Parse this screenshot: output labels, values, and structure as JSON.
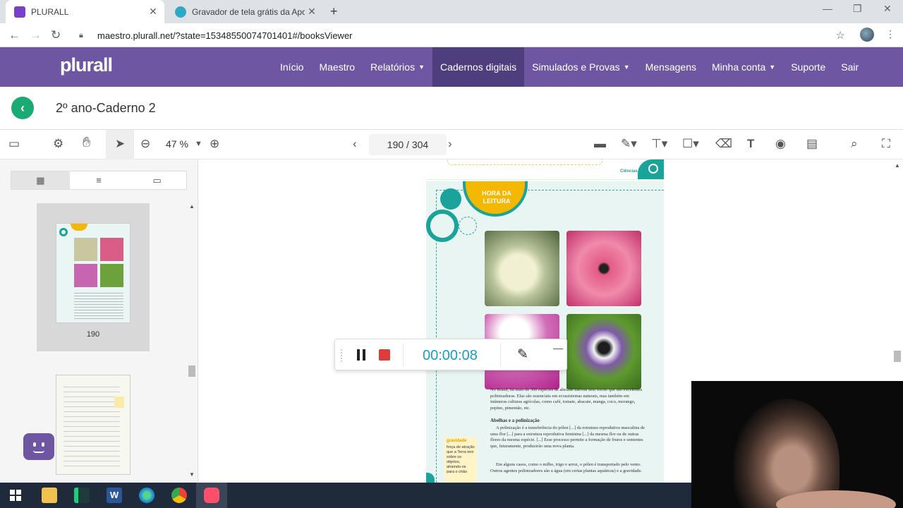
{
  "browser": {
    "tabs": [
      {
        "title": "PLURALL",
        "active": true
      },
      {
        "title": "Gravador de tela grátis da Apowersoft",
        "active": false
      }
    ],
    "new_tab": "+",
    "url": "maestro.plurall.net/?state=15348550074701401#/booksViewer"
  },
  "nav": {
    "logo": "plurall",
    "items": [
      {
        "label": "Início",
        "caret": false,
        "active": false
      },
      {
        "label": "Maestro",
        "caret": false,
        "active": false
      },
      {
        "label": "Relatórios",
        "caret": true,
        "active": false
      },
      {
        "label": "Cadernos digitais",
        "caret": false,
        "active": true
      },
      {
        "label": "Simulados e Provas",
        "caret": true,
        "active": false
      },
      {
        "label": "Mensagens",
        "caret": false,
        "active": false
      },
      {
        "label": "Minha conta",
        "caret": true,
        "active": false
      },
      {
        "label": "Suporte",
        "caret": false,
        "active": false
      },
      {
        "label": "Sair",
        "caret": false,
        "active": false
      }
    ]
  },
  "document": {
    "title": "2º ano-Caderno 2"
  },
  "toolbar": {
    "zoom": "47 %",
    "page_indicator": "190 / 304"
  },
  "sidebar": {
    "thumb_label": "190"
  },
  "page": {
    "section_badge": "HORA DA LEITURA",
    "corner_label": "Ciências",
    "intro": "No Brasil, há mais de 300 espécies de abelhas nativas sem ferrão que são excelentes polinizadoras. Elas são essenciais em ecossistemas naturais, mas também em inúmeras culturas agrícolas, como café, tomate, abacate, manga, coco, morango, pepino, pimentão, etc.",
    "heading": "Abelhas e a polinização",
    "para1": "A polinização é a transferência do pólen [...] da estrutura reprodutiva masculina de uma flor [...] para a estrutura reprodutiva feminina [...] da mesma flor ou de outras flores da mesma espécie. [...] Esse processo permite a formação de frutos e sementes que, futuramente, produzirão uma nova planta.",
    "para2": "Em alguns casos, como o milho, trigo e arroz, o pólen é transportado pelo vento. Outros agentes polinizadores são a água (em certas plantas aquáticas) e a gravidade.",
    "glossary_term": "gravidade",
    "glossary_def": "força de atração que a Terra tem sobre os objetos, atraindo-os para o chão"
  },
  "recorder": {
    "timer": "00:00:08"
  },
  "colors": {
    "brand_purple": "#6e56a3",
    "nav_active": "#4e3e7e",
    "accent_green": "#1aaa73",
    "timer_blue": "#1a9ec2",
    "stop_red": "#e03a3a"
  }
}
